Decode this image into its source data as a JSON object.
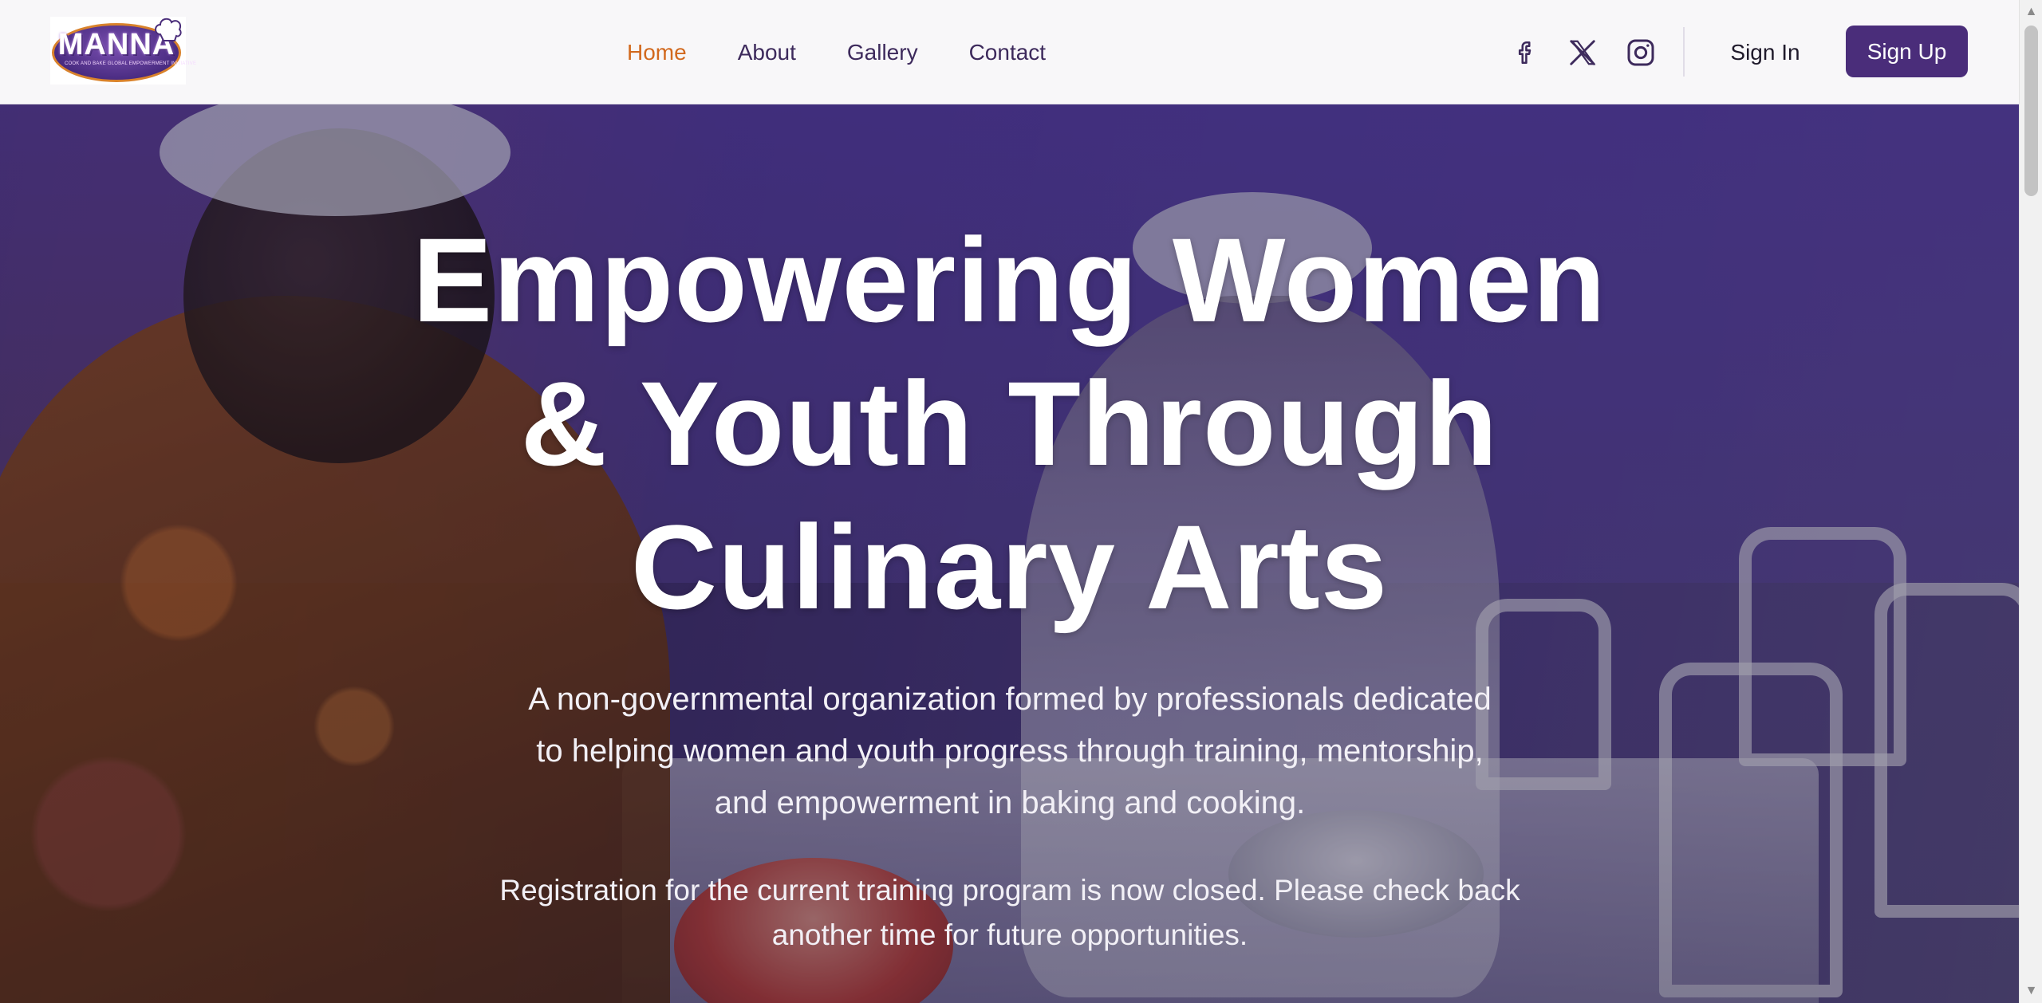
{
  "brand": {
    "logo_text": "MANNA",
    "logo_tagline": "COOK AND BAKE GLOBAL EMPOWERMENT INITIATIVE"
  },
  "nav": {
    "items": [
      {
        "label": "Home",
        "active": true
      },
      {
        "label": "About",
        "active": false
      },
      {
        "label": "Gallery",
        "active": false
      },
      {
        "label": "Contact",
        "active": false
      }
    ],
    "active_color": "#d2691e",
    "link_color": "#3d2a5c"
  },
  "social": [
    {
      "icon": "facebook-icon"
    },
    {
      "icon": "x-twitter-icon"
    },
    {
      "icon": "instagram-icon"
    }
  ],
  "auth": {
    "sign_in_label": "Sign In",
    "sign_up_label": "Sign Up",
    "sign_up_color": "#4a2d7a"
  },
  "hero": {
    "title_line1": "Empowering Women",
    "title_line2": "& Youth Through",
    "title_line3": "Culinary Arts",
    "subtitle_line1": "A non-governmental organization formed by professionals dedicated",
    "subtitle_line2": "to helping women and youth progress through training, mentorship,",
    "subtitle_line3": "and empowerment in baking and cooking.",
    "notice_line1": "Registration for the current training program is now closed. Please check back",
    "notice_line2": "another time for future opportunities.",
    "overlay_color": "#3a286e"
  }
}
